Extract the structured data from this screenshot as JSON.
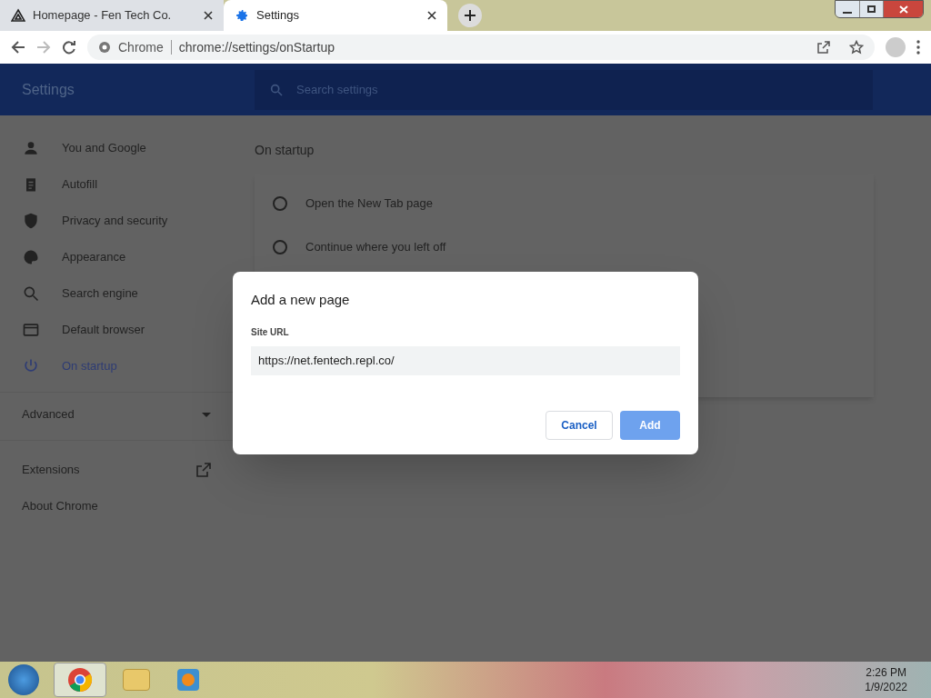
{
  "tabs": [
    {
      "title": "Homepage - Fen Tech Co.",
      "kind": "site",
      "selected": false
    },
    {
      "title": "Settings",
      "kind": "settings",
      "selected": true
    }
  ],
  "address_bar": {
    "site_label": "Chrome",
    "url": "chrome://settings/onStartup"
  },
  "settings_header": {
    "title": "Settings",
    "search_placeholder": "Search settings"
  },
  "sidebar": {
    "items": [
      {
        "label": "You and Google",
        "kind": "person",
        "selected": false
      },
      {
        "label": "Autofill",
        "kind": "clipboard",
        "selected": false
      },
      {
        "label": "Privacy and security",
        "kind": "shield",
        "selected": false
      },
      {
        "label": "Appearance",
        "kind": "palette",
        "selected": false
      },
      {
        "label": "Search engine",
        "kind": "search",
        "selected": false
      },
      {
        "label": "Default browser",
        "kind": "browser",
        "selected": false
      },
      {
        "label": "On startup",
        "kind": "power",
        "selected": true
      }
    ],
    "advanced": "Advanced",
    "extensions": "Extensions",
    "about": "About Chrome"
  },
  "section": {
    "title": "On startup",
    "options": [
      {
        "label": "Open the New Tab page",
        "selected": false
      },
      {
        "label": "Continue where you left off",
        "selected": false
      }
    ]
  },
  "dialog": {
    "title": "Add a new page",
    "field_label": "Site URL",
    "field_value": "https://net.fentech.repl.co/",
    "buttons": [
      {
        "label": "Cancel",
        "kind": "secondary"
      },
      {
        "label": "Add",
        "kind": "primary"
      }
    ]
  },
  "taskbar": {
    "time": "2:26 PM",
    "date": "1/9/2022"
  }
}
